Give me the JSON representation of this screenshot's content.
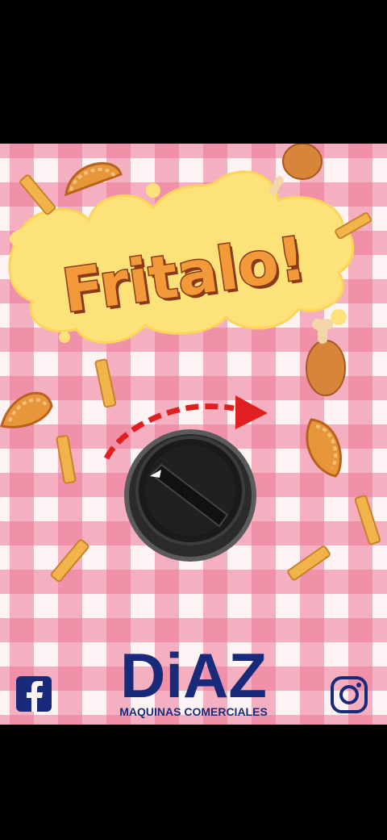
{
  "title": "Fritalo!",
  "brand": {
    "name": "DiAZ",
    "tagline": "MAQUINAS COMERCIALES",
    "color": "#1a2a7a"
  },
  "knob": {
    "rotate_hint_icon": "arrow-right-icon",
    "hint_color": "#e02020"
  },
  "social": {
    "left_icon": "facebook-icon",
    "right_icon": "instagram-icon"
  },
  "colors": {
    "title_fill": "#f29a3a",
    "title_outline": "#8a3a1a",
    "splash": "#fde27a",
    "gingham": "#ec7896"
  }
}
